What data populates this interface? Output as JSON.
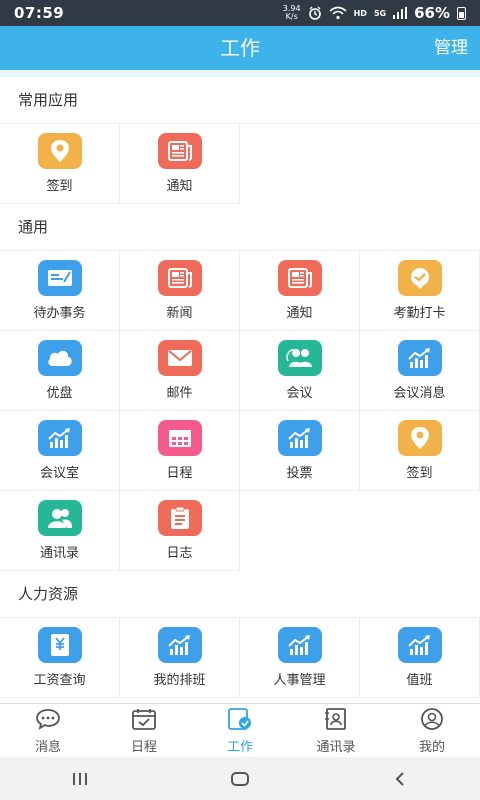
{
  "status_bar": {
    "time": "07:59",
    "net_speed_value": "3.94",
    "net_speed_unit": "K/s",
    "hd": "HD",
    "signal": "5G",
    "battery": "66%"
  },
  "header": {
    "title": "工作",
    "manage_label": "管理"
  },
  "sections": [
    {
      "title": "常用应用",
      "items": [
        {
          "label": "签到",
          "icon": "location-pin-icon",
          "color": "#f3b14a"
        },
        {
          "label": "通知",
          "icon": "newspaper-icon",
          "color": "#ef6a59"
        }
      ]
    },
    {
      "title": "通用",
      "items": [
        {
          "label": "待办事务",
          "icon": "id-card-icon",
          "color": "#3ea0ea"
        },
        {
          "label": "新闻",
          "icon": "newspaper-icon",
          "color": "#ef6a59"
        },
        {
          "label": "通知",
          "icon": "newspaper-icon",
          "color": "#ef6a59"
        },
        {
          "label": "考勤打卡",
          "icon": "check-badge-icon",
          "color": "#f3b14a"
        },
        {
          "label": "优盘",
          "icon": "cloud-icon",
          "color": "#3ea0ea"
        },
        {
          "label": "邮件",
          "icon": "mail-icon",
          "color": "#ef6a59"
        },
        {
          "label": "会议",
          "icon": "group-icon",
          "color": "#26b796"
        },
        {
          "label": "会议消息",
          "icon": "chart-icon",
          "color": "#3ea0ea"
        },
        {
          "label": "会议室",
          "icon": "chart-icon",
          "color": "#3ea0ea"
        },
        {
          "label": "日程",
          "icon": "calendar-icon",
          "color": "#f45b8c"
        },
        {
          "label": "投票",
          "icon": "chart-icon",
          "color": "#3ea0ea"
        },
        {
          "label": "签到",
          "icon": "location-pin-icon",
          "color": "#f3b14a"
        },
        {
          "label": "通讯录",
          "icon": "contacts-icon",
          "color": "#26b796"
        },
        {
          "label": "日志",
          "icon": "clipboard-icon",
          "color": "#ef6a59"
        }
      ]
    },
    {
      "title": "人力资源",
      "items": [
        {
          "label": "工资查询",
          "icon": "yen-card-icon",
          "color": "#3ea0ea"
        },
        {
          "label": "我的排班",
          "icon": "chart-icon",
          "color": "#3ea0ea"
        },
        {
          "label": "人事管理",
          "icon": "chart-icon",
          "color": "#3ea0ea"
        },
        {
          "label": "值班",
          "icon": "chart-icon",
          "color": "#3ea0ea"
        }
      ]
    }
  ],
  "tabbar": [
    {
      "label": "消息",
      "icon": "chat-icon",
      "active": false
    },
    {
      "label": "日程",
      "icon": "calendar-check-icon",
      "active": false
    },
    {
      "label": "工作",
      "icon": "work-icon",
      "active": true
    },
    {
      "label": "通讯录",
      "icon": "address-book-icon",
      "active": false
    },
    {
      "label": "我的",
      "icon": "user-icon",
      "active": false
    }
  ],
  "navbar": [
    "recents-icon",
    "home-icon",
    "back-icon"
  ],
  "colors": {
    "accent": "#3db3ea",
    "active_tab": "#2aa8e6"
  }
}
